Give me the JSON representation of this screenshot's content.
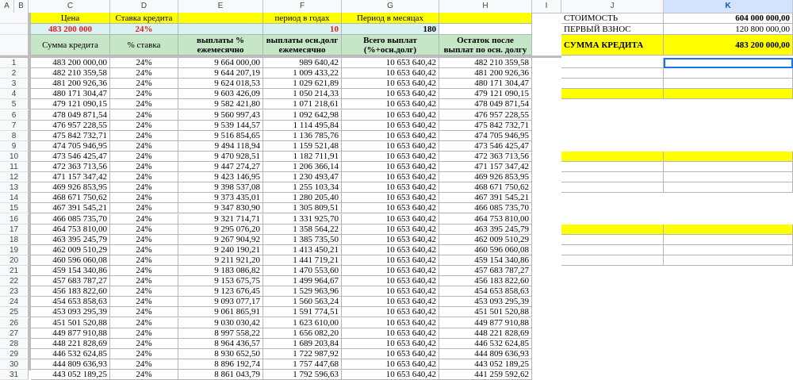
{
  "columns": [
    "A",
    "B",
    "C",
    "D",
    "E",
    "F",
    "G",
    "H",
    "I",
    "J",
    "K"
  ],
  "header_rows": {
    "r1": {
      "c": "Цена",
      "d": "Ставка кредита",
      "f": "период в годах",
      "g": "Период в месяцах"
    },
    "r2": {
      "c": "483 200 000",
      "d": "24%",
      "f": "10",
      "g": "180"
    },
    "r3": {
      "c": "Сумма кредита",
      "d": "% ставка",
      "e": "выплаты % ежемесячно",
      "f": "выплаты осн.долг ежемесячно",
      "g": "Всего выплат (%+осн.долг)",
      "h": "Остаток после выплат по осн. долгу"
    }
  },
  "summary": {
    "cost_label": "СТОИМОСТЬ",
    "cost_value": "604 000 000,00",
    "down_label": "ПЕРВЫЙ ВЗНОС",
    "down_value": "120 800 000,00",
    "loan_label": "СУММА КРЕДИТА",
    "loan_value": "483 200 000,00"
  },
  "rows": [
    {
      "n": "1",
      "c": "483 200 000,00",
      "d": "24%",
      "e": "9 664 000,00",
      "f": "989 640,42",
      "g": "10 653 640,42",
      "h": "482 210 359,58"
    },
    {
      "n": "2",
      "c": "482 210 359,58",
      "d": "24%",
      "e": "9 644 207,19",
      "f": "1 009 433,22",
      "g": "10 653 640,42",
      "h": "481 200 926,36"
    },
    {
      "n": "3",
      "c": "481 200 926,36",
      "d": "24%",
      "e": "9 624 018,53",
      "f": "1 029 621,89",
      "g": "10 653 640,42",
      "h": "480 171 304,47"
    },
    {
      "n": "4",
      "c": "480 171 304,47",
      "d": "24%",
      "e": "9 603 426,09",
      "f": "1 050 214,33",
      "g": "10 653 640,42",
      "h": "479 121 090,15"
    },
    {
      "n": "5",
      "c": "479 121 090,15",
      "d": "24%",
      "e": "9 582 421,80",
      "f": "1 071 218,61",
      "g": "10 653 640,42",
      "h": "478 049 871,54"
    },
    {
      "n": "6",
      "c": "478 049 871,54",
      "d": "24%",
      "e": "9 560 997,43",
      "f": "1 092 642,98",
      "g": "10 653 640,42",
      "h": "476 957 228,55"
    },
    {
      "n": "7",
      "c": "476 957 228,55",
      "d": "24%",
      "e": "9 539 144,57",
      "f": "1 114 495,84",
      "g": "10 653 640,42",
      "h": "475 842 732,71"
    },
    {
      "n": "8",
      "c": "475 842 732,71",
      "d": "24%",
      "e": "9 516 854,65",
      "f": "1 136 785,76",
      "g": "10 653 640,42",
      "h": "474 705 946,95"
    },
    {
      "n": "9",
      "c": "474 705 946,95",
      "d": "24%",
      "e": "9 494 118,94",
      "f": "1 159 521,48",
      "g": "10 653 640,42",
      "h": "473 546 425,47"
    },
    {
      "n": "10",
      "c": "473 546 425,47",
      "d": "24%",
      "e": "9 470 928,51",
      "f": "1 182 711,91",
      "g": "10 653 640,42",
      "h": "472 363 713,56"
    },
    {
      "n": "11",
      "c": "472 363 713,56",
      "d": "24%",
      "e": "9 447 274,27",
      "f": "1 206 366,14",
      "g": "10 653 640,42",
      "h": "471 157 347,42"
    },
    {
      "n": "12",
      "c": "471 157 347,42",
      "d": "24%",
      "e": "9 423 146,95",
      "f": "1 230 493,47",
      "g": "10 653 640,42",
      "h": "469 926 853,95"
    },
    {
      "n": "13",
      "c": "469 926 853,95",
      "d": "24%",
      "e": "9 398 537,08",
      "f": "1 255 103,34",
      "g": "10 653 640,42",
      "h": "468 671 750,62"
    },
    {
      "n": "14",
      "c": "468 671 750,62",
      "d": "24%",
      "e": "9 373 435,01",
      "f": "1 280 205,40",
      "g": "10 653 640,42",
      "h": "467 391 545,21"
    },
    {
      "n": "15",
      "c": "467 391 545,21",
      "d": "24%",
      "e": "9 347 830,90",
      "f": "1 305 809,51",
      "g": "10 653 640,42",
      "h": "466 085 735,70"
    },
    {
      "n": "16",
      "c": "466 085 735,70",
      "d": "24%",
      "e": "9 321 714,71",
      "f": "1 331 925,70",
      "g": "10 653 640,42",
      "h": "464 753 810,00"
    },
    {
      "n": "17",
      "c": "464 753 810,00",
      "d": "24%",
      "e": "9 295 076,20",
      "f": "1 358 564,22",
      "g": "10 653 640,42",
      "h": "463 395 245,79"
    },
    {
      "n": "18",
      "c": "463 395 245,79",
      "d": "24%",
      "e": "9 267 904,92",
      "f": "1 385 735,50",
      "g": "10 653 640,42",
      "h": "462 009 510,29"
    },
    {
      "n": "19",
      "c": "462 009 510,29",
      "d": "24%",
      "e": "9 240 190,21",
      "f": "1 413 450,21",
      "g": "10 653 640,42",
      "h": "460 596 060,08"
    },
    {
      "n": "20",
      "c": "460 596 060,08",
      "d": "24%",
      "e": "9 211 921,20",
      "f": "1 441 719,21",
      "g": "10 653 640,42",
      "h": "459 154 340,86"
    },
    {
      "n": "21",
      "c": "459 154 340,86",
      "d": "24%",
      "e": "9 183 086,82",
      "f": "1 470 553,60",
      "g": "10 653 640,42",
      "h": "457 683 787,27"
    },
    {
      "n": "22",
      "c": "457 683 787,27",
      "d": "24%",
      "e": "9 153 675,75",
      "f": "1 499 964,67",
      "g": "10 653 640,42",
      "h": "456 183 822,60"
    },
    {
      "n": "23",
      "c": "456 183 822,60",
      "d": "24%",
      "e": "9 123 676,45",
      "f": "1 529 963,96",
      "g": "10 653 640,42",
      "h": "454 653 858,63"
    },
    {
      "n": "24",
      "c": "454 653 858,63",
      "d": "24%",
      "e": "9 093 077,17",
      "f": "1 560 563,24",
      "g": "10 653 640,42",
      "h": "453 093 295,39"
    },
    {
      "n": "25",
      "c": "453 093 295,39",
      "d": "24%",
      "e": "9 061 865,91",
      "f": "1 591 774,51",
      "g": "10 653 640,42",
      "h": "451 501 520,88"
    },
    {
      "n": "26",
      "c": "451 501 520,88",
      "d": "24%",
      "e": "9 030 030,42",
      "f": "1 623 610,00",
      "g": "10 653 640,42",
      "h": "449 877 910,88"
    },
    {
      "n": "27",
      "c": "449 877 910,88",
      "d": "24%",
      "e": "8 997 558,22",
      "f": "1 656 082,20",
      "g": "10 653 640,42",
      "h": "448 221 828,69"
    },
    {
      "n": "28",
      "c": "448 221 828,69",
      "d": "24%",
      "e": "8 964 436,57",
      "f": "1 689 203,84",
      "g": "10 653 640,42",
      "h": "446 532 624,85"
    },
    {
      "n": "29",
      "c": "446 532 624,85",
      "d": "24%",
      "e": "8 930 652,50",
      "f": "1 722 987,92",
      "g": "10 653 640,42",
      "h": "444 809 636,93"
    },
    {
      "n": "30",
      "c": "444 809 636,93",
      "d": "24%",
      "e": "8 896 192,74",
      "f": "1 757 447,68",
      "g": "10 653 640,42",
      "h": "443 052 189,25"
    },
    {
      "n": "31",
      "c": "443 052 189,25",
      "d": "24%",
      "e": "8 861 043,79",
      "f": "1 792 596,63",
      "g": "10 653 640,42",
      "h": "441 259 592,62"
    }
  ]
}
